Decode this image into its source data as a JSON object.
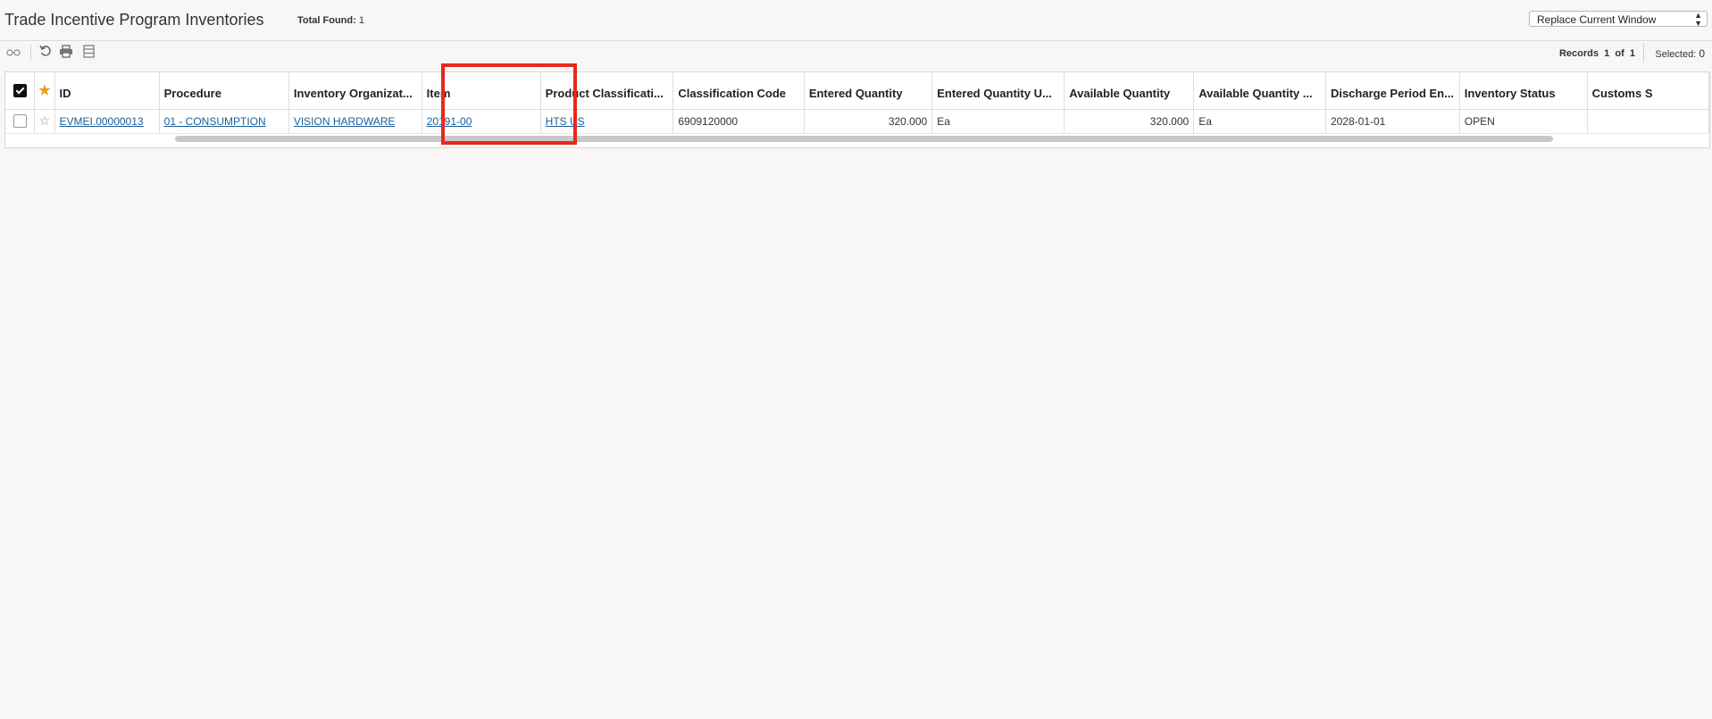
{
  "header": {
    "title": "Trade Incentive Program Inventories",
    "total_label": "Total Found:",
    "total_value": "1",
    "window_select": "Replace Current Window"
  },
  "toolbar": {
    "icons": [
      "view-glasses-icon",
      "refresh-icon",
      "print-icon",
      "columns-icon"
    ],
    "records_label": "Records",
    "records_from": "1",
    "records_of": "of",
    "records_total": "1",
    "selected_label": "Selected:",
    "selected_value": "0"
  },
  "table": {
    "columns": [
      "ID",
      "Procedure",
      "Inventory Organizat...",
      "Item",
      "Product Classificati...",
      "Classification Code",
      "Entered Quantity",
      "Entered Quantity U...",
      "Available Quantity",
      "Available Quantity ...",
      "Discharge Period En...",
      "Inventory Status",
      "Customs S"
    ],
    "rows": [
      {
        "id": "EVMEI.00000013",
        "procedure": "01 - CONSUMPTION",
        "inventory_org": "VISION HARDWARE",
        "item": "20191-00",
        "product_classification": "HTS US",
        "classification_code": "6909120000",
        "entered_quantity": "320.000",
        "entered_quantity_uom": "Ea",
        "available_quantity": "320.000",
        "available_quantity_uom": "Ea",
        "discharge_period_end": "2028-01-01",
        "inventory_status": "OPEN",
        "customs": ""
      }
    ]
  },
  "colors": {
    "link": "#1a5e9a",
    "highlight": "#e8281e",
    "star": "#e3a21a"
  }
}
